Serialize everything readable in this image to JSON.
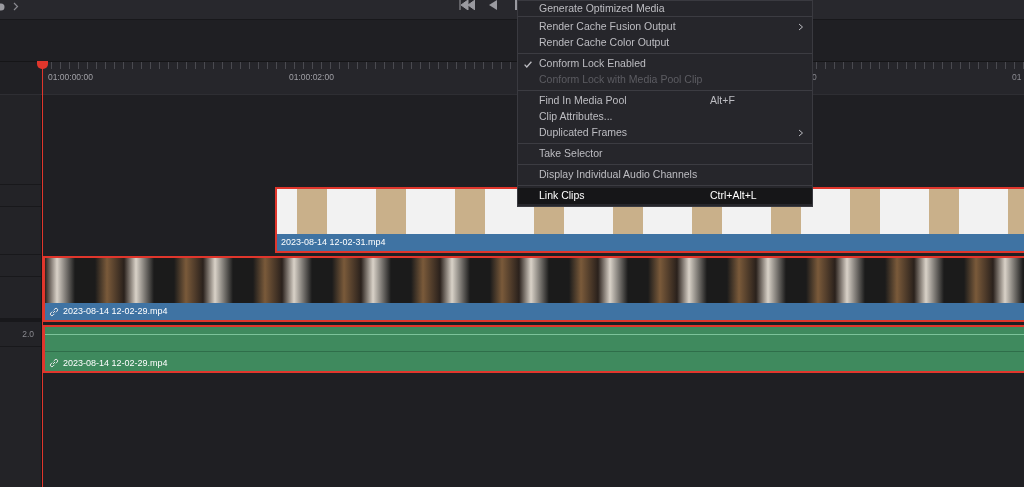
{
  "ruler": {
    "labels": [
      {
        "text": "01:00:00:00",
        "kind": "full"
      },
      {
        "text": "01:00:02:00",
        "kind": "full"
      },
      {
        "text": "0",
        "kind": "partial"
      },
      {
        "text": "01",
        "kind": "partial"
      }
    ]
  },
  "audio_track": {
    "label": "2.0"
  },
  "clips": [
    {
      "kind": "screen",
      "name": "2023-08-14 12-02-31.mp4",
      "linked": false,
      "selected": true
    },
    {
      "kind": "camera",
      "name": "2023-08-14 12-02-29.mp4",
      "linked": true,
      "selected": true
    },
    {
      "kind": "audio",
      "name": "2023-08-14 12-02-29.mp4",
      "linked": true,
      "selected": true
    }
  ],
  "context_menu": {
    "groups": [
      [
        {
          "label": "Generate Optimized Media",
          "checked": false,
          "disabled": false,
          "submenu": false,
          "selected": false
        }
      ],
      [
        {
          "label": "Render Cache Fusion Output",
          "checked": false,
          "disabled": false,
          "submenu": true,
          "selected": false
        },
        {
          "label": "Render Cache Color Output",
          "checked": false,
          "disabled": false,
          "submenu": false,
          "selected": false
        }
      ],
      [
        {
          "label": "Conform Lock Enabled",
          "checked": true,
          "disabled": false,
          "submenu": false,
          "selected": false
        },
        {
          "label": "Conform Lock with Media Pool Clip",
          "checked": false,
          "disabled": true,
          "submenu": false,
          "selected": false
        }
      ],
      [
        {
          "label": "Find In Media Pool",
          "shortcut": "Alt+F",
          "checked": false,
          "disabled": false,
          "submenu": false,
          "selected": false
        },
        {
          "label": "Clip Attributes...",
          "checked": false,
          "disabled": false,
          "submenu": false,
          "selected": false
        },
        {
          "label": "Duplicated Frames",
          "checked": false,
          "disabled": false,
          "submenu": true,
          "selected": false
        }
      ],
      [
        {
          "label": "Take Selector",
          "checked": false,
          "disabled": false,
          "submenu": false,
          "selected": false
        }
      ],
      [
        {
          "label": "Display Individual Audio Channels",
          "checked": false,
          "disabled": false,
          "submenu": false,
          "selected": false
        }
      ],
      [
        {
          "label": "Link Clips",
          "shortcut": "Ctrl+Alt+L",
          "checked": false,
          "disabled": false,
          "submenu": false,
          "selected": true
        }
      ]
    ]
  }
}
